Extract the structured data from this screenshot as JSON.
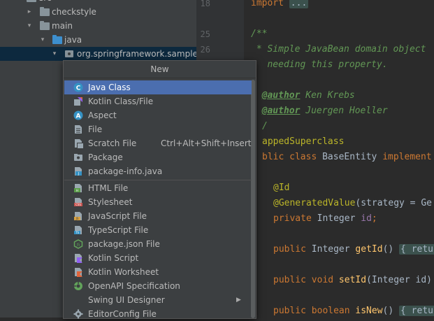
{
  "project_tree": {
    "items": [
      {
        "label": "src",
        "expanded": true
      },
      {
        "label": "checkstyle",
        "expanded": false
      },
      {
        "label": "main",
        "expanded": true
      },
      {
        "label": "java",
        "expanded": true
      },
      {
        "label": "org.springframework.samples.pe",
        "expanded": true
      }
    ]
  },
  "editor": {
    "line_numbers": [
      "18",
      "25",
      "26"
    ],
    "lines": {
      "import_kw": "import",
      "import_fold": "...",
      "javadoc_open": "/**",
      "desc1": " * Simple JavaBean domain object",
      "desc2": "   needing this property.",
      "author_tag": "@author",
      "author1": " Ken Krebs",
      "author2": " Juergen Hoeller",
      "javadoc_close": "/",
      "mapped": "appedSuperclass",
      "class_kw": "blic class",
      "class_name": " BaseEntity ",
      "implements": "implement",
      "id_ann": "@Id",
      "gen_ann": "@GeneratedValue",
      "gen_rest": "(strategy = Ge",
      "private_kw": "private",
      "field_type": " Integer ",
      "field_name": "id",
      "semi": ";",
      "public_kw": "public",
      "integer": " Integer ",
      "getid": "getId",
      "getid_paren": "() ",
      "fold_brace": "{ retu",
      "void_kw": "public void ",
      "setid": "setId",
      "setid_rest": "(Integer id)",
      "bool_kw": "public boolean ",
      "isnew": "isNew",
      "isnew_paren": "() ",
      "fold_brace2": "{ retu"
    }
  },
  "popup": {
    "title": "New",
    "items": [
      {
        "label": "Java Class",
        "icon": "java-class-icon",
        "highlighted": true
      },
      {
        "label": "Kotlin Class/File",
        "icon": "kotlin-class-icon"
      },
      {
        "label": "Aspect",
        "icon": "aspect-icon"
      },
      {
        "label": "File",
        "icon": "file-icon"
      },
      {
        "label": "Scratch File",
        "icon": "scratch-file-icon",
        "shortcut": "Ctrl+Alt+Shift+Insert"
      },
      {
        "label": "Package",
        "icon": "package-icon"
      },
      {
        "label": "package-info.java",
        "icon": "java-file-icon"
      },
      {
        "label": "HTML File",
        "icon": "html-file-icon"
      },
      {
        "label": "Stylesheet",
        "icon": "css-file-icon"
      },
      {
        "label": "JavaScript File",
        "icon": "javascript-file-icon"
      },
      {
        "label": "TypeScript File",
        "icon": "typescript-file-icon"
      },
      {
        "label": "package.json File",
        "icon": "nodejs-icon"
      },
      {
        "label": "Kotlin Script",
        "icon": "kotlin-script-icon"
      },
      {
        "label": "Kotlin Worksheet",
        "icon": "kotlin-worksheet-icon"
      },
      {
        "label": "OpenAPI Specification",
        "icon": "openapi-icon"
      },
      {
        "label": "Swing UI Designer",
        "icon": "none",
        "submenu": "▶"
      },
      {
        "label": "EditorConfig File",
        "icon": "gear-icon"
      }
    ]
  },
  "colors": {
    "highlight": "#4b6eaf",
    "tree_selection": "#0d293e",
    "popup_bg": "#3c3f41",
    "editor_bg": "#2b2b2b"
  }
}
